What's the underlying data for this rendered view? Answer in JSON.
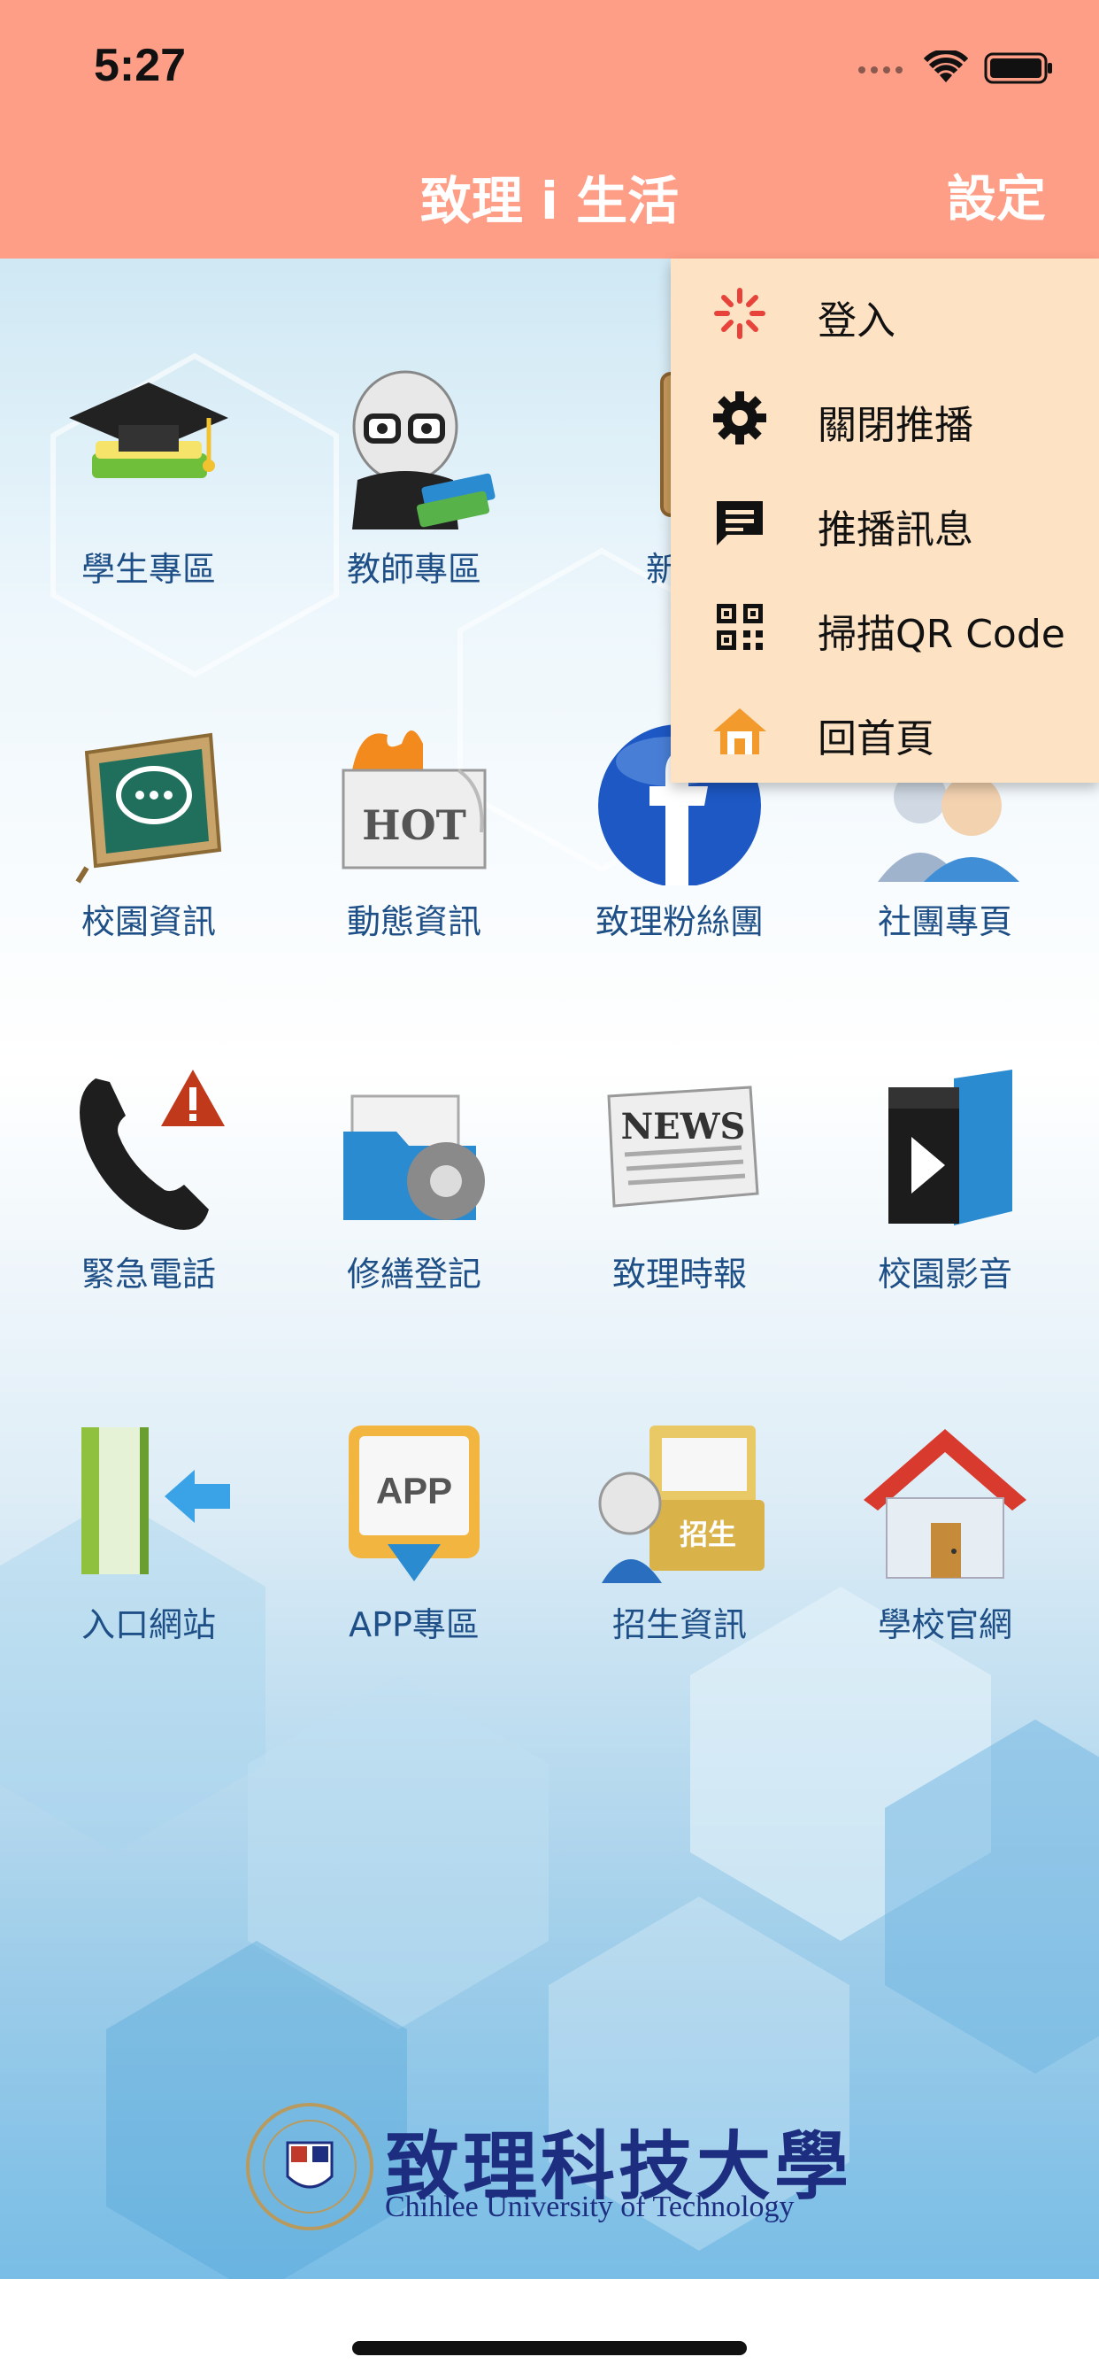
{
  "status_bar": {
    "time": "5:27"
  },
  "header": {
    "title": "致理 i 生活",
    "settings_label": "設定"
  },
  "grid": [
    {
      "label": "學生專區",
      "icon": "graduation-cap-icon"
    },
    {
      "label": "教師專區",
      "icon": "teacher-icon"
    },
    {
      "label": "新生",
      "icon": "new-student-icon"
    },
    {
      "label": "",
      "icon": "hidden-icon"
    },
    {
      "label": "校園資訊",
      "icon": "chalkboard-chat-icon"
    },
    {
      "label": "動態資訊",
      "icon": "hot-icon"
    },
    {
      "label": "致理粉絲團",
      "icon": "facebook-icon"
    },
    {
      "label": "社團專頁",
      "icon": "club-people-icon"
    },
    {
      "label": "緊急電話",
      "icon": "phone-alert-icon"
    },
    {
      "label": "修繕登記",
      "icon": "folder-gear-icon"
    },
    {
      "label": "致理時報",
      "icon": "newspaper-icon"
    },
    {
      "label": "校園影音",
      "icon": "video-clapper-icon"
    },
    {
      "label": "入口網站",
      "icon": "portal-door-icon"
    },
    {
      "label": "APP專區",
      "icon": "app-download-icon"
    },
    {
      "label": "招生資訊",
      "icon": "admission-folder-icon"
    },
    {
      "label": "學校官網",
      "icon": "school-house-icon"
    }
  ],
  "grid_icon_texts": {
    "hot": "HOT",
    "news": "NEWS",
    "app": "APP",
    "admission": "招生"
  },
  "dropdown": {
    "items": [
      {
        "label": "登入",
        "icon": "login-spinner-icon"
      },
      {
        "label": "關閉推播",
        "icon": "gear-icon"
      },
      {
        "label": "推播訊息",
        "icon": "message-icon"
      },
      {
        "label": "掃描QR Code",
        "icon": "qr-code-icon"
      },
      {
        "label": "回首頁",
        "icon": "home-icon"
      }
    ]
  },
  "logo": {
    "chinese": "致理科技大學",
    "english": "Chihlee University of Technology"
  },
  "colors": {
    "header": "#ff9e86",
    "dropdown": "#fde2c4",
    "label": "#1e4f86",
    "logo": "#1d2d80"
  }
}
